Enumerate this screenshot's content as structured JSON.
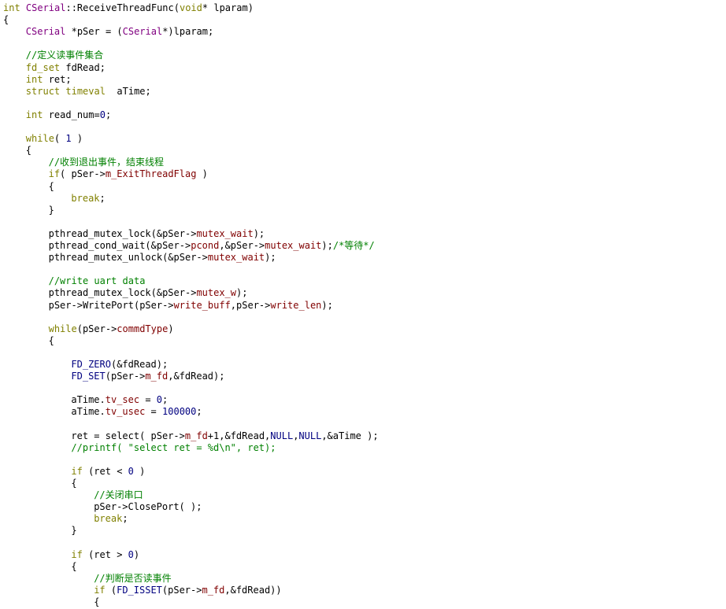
{
  "editor": {
    "lines": [
      {
        "t": 0,
        "indent": 0,
        "tokens": [
          {
            "c": "k",
            "v": "int "
          },
          {
            "c": "cls",
            "v": "CSerial"
          },
          {
            "c": "f",
            "v": "::ReceiveThreadFunc("
          },
          {
            "c": "k",
            "v": "void"
          },
          {
            "c": "f",
            "v": "* lparam)"
          }
        ]
      },
      {
        "t": 1,
        "indent": 0,
        "tokens": [
          {
            "c": "f",
            "v": "{"
          }
        ]
      },
      {
        "t": 2,
        "indent": 1,
        "tokens": [
          {
            "c": "cls",
            "v": "CSerial"
          },
          {
            "c": "f",
            "v": " *pSer = ("
          },
          {
            "c": "cls",
            "v": "CSerial"
          },
          {
            "c": "f",
            "v": "*)lparam;"
          }
        ]
      },
      {
        "t": 4,
        "indent": 1,
        "tokens": [
          {
            "c": "c",
            "v": "//定义读事件集合"
          }
        ]
      },
      {
        "t": 5,
        "indent": 1,
        "tokens": [
          {
            "c": "k",
            "v": "fd_set"
          },
          {
            "c": "f",
            "v": " fdRead;"
          }
        ]
      },
      {
        "t": 6,
        "indent": 1,
        "tokens": [
          {
            "c": "k",
            "v": "int"
          },
          {
            "c": "f",
            "v": " ret;"
          }
        ]
      },
      {
        "t": 7,
        "indent": 1,
        "tokens": [
          {
            "c": "k",
            "v": "struct timeval"
          },
          {
            "c": "f",
            "v": "  aTime;"
          }
        ]
      },
      {
        "t": 9,
        "indent": 1,
        "tokens": [
          {
            "c": "k",
            "v": "int"
          },
          {
            "c": "f",
            "v": " read_num="
          },
          {
            "c": "n",
            "v": "0"
          },
          {
            "c": "f",
            "v": ";"
          }
        ]
      },
      {
        "t": 11,
        "indent": 1,
        "tokens": [
          {
            "c": "k",
            "v": "while"
          },
          {
            "c": "f",
            "v": "( "
          },
          {
            "c": "n",
            "v": "1"
          },
          {
            "c": "f",
            "v": " )"
          }
        ]
      },
      {
        "t": 12,
        "indent": 1,
        "tokens": [
          {
            "c": "f",
            "v": "{"
          }
        ]
      },
      {
        "t": 13,
        "indent": 2,
        "tokens": [
          {
            "c": "c",
            "v": "//收到退出事件，结束线程"
          }
        ]
      },
      {
        "t": 14,
        "indent": 2,
        "tokens": [
          {
            "c": "k",
            "v": "if"
          },
          {
            "c": "f",
            "v": "( pSer->"
          },
          {
            "c": "m",
            "v": "m_ExitThreadFlag"
          },
          {
            "c": "f",
            "v": " )"
          }
        ]
      },
      {
        "t": 15,
        "indent": 2,
        "tokens": [
          {
            "c": "f",
            "v": "{"
          }
        ]
      },
      {
        "t": 16,
        "indent": 3,
        "tokens": [
          {
            "c": "k",
            "v": "break"
          },
          {
            "c": "f",
            "v": ";"
          }
        ]
      },
      {
        "t": 17,
        "indent": 2,
        "tokens": [
          {
            "c": "f",
            "v": "}"
          }
        ]
      },
      {
        "t": 19,
        "indent": 2,
        "tokens": [
          {
            "c": "f",
            "v": "pthread_mutex_lock(&pSer->"
          },
          {
            "c": "m",
            "v": "mutex_wait"
          },
          {
            "c": "f",
            "v": ");"
          }
        ]
      },
      {
        "t": 20,
        "indent": 2,
        "tokens": [
          {
            "c": "f",
            "v": "pthread_cond_wait(&pSer->"
          },
          {
            "c": "m",
            "v": "pcond"
          },
          {
            "c": "f",
            "v": ",&pSer->"
          },
          {
            "c": "m",
            "v": "mutex_wait"
          },
          {
            "c": "f",
            "v": ");"
          },
          {
            "c": "c",
            "v": "/*等待*/"
          }
        ]
      },
      {
        "t": 21,
        "indent": 2,
        "tokens": [
          {
            "c": "f",
            "v": "pthread_mutex_unlock(&pSer->"
          },
          {
            "c": "m",
            "v": "mutex_wait"
          },
          {
            "c": "f",
            "v": ");"
          }
        ]
      },
      {
        "t": 23,
        "indent": 2,
        "tokens": [
          {
            "c": "c",
            "v": "//write uart data"
          }
        ]
      },
      {
        "t": 24,
        "indent": 2,
        "tokens": [
          {
            "c": "f",
            "v": "pthread_mutex_lock(&pSer->"
          },
          {
            "c": "m",
            "v": "mutex_w"
          },
          {
            "c": "f",
            "v": ");"
          }
        ]
      },
      {
        "t": 25,
        "indent": 2,
        "tokens": [
          {
            "c": "f",
            "v": "pSer->WritePort(pSer->"
          },
          {
            "c": "m",
            "v": "write_buff"
          },
          {
            "c": "f",
            "v": ",pSer->"
          },
          {
            "c": "m",
            "v": "write_len"
          },
          {
            "c": "f",
            "v": ");"
          }
        ]
      },
      {
        "t": 27,
        "indent": 2,
        "tokens": [
          {
            "c": "k",
            "v": "while"
          },
          {
            "c": "f",
            "v": "(pSer->"
          },
          {
            "c": "m",
            "v": "commdType"
          },
          {
            "c": "f",
            "v": ")"
          }
        ]
      },
      {
        "t": 28,
        "indent": 2,
        "tokens": [
          {
            "c": "f",
            "v": "{"
          }
        ]
      },
      {
        "t": 30,
        "indent": 3,
        "tokens": [
          {
            "c": "n",
            "v": "FD_ZERO"
          },
          {
            "c": "f",
            "v": "(&fdRead);"
          }
        ]
      },
      {
        "t": 31,
        "indent": 3,
        "tokens": [
          {
            "c": "n",
            "v": "FD_SET"
          },
          {
            "c": "f",
            "v": "(pSer->"
          },
          {
            "c": "m",
            "v": "m_fd"
          },
          {
            "c": "f",
            "v": ",&fdRead);"
          }
        ]
      },
      {
        "t": 33,
        "indent": 3,
        "tokens": [
          {
            "c": "f",
            "v": "aTime."
          },
          {
            "c": "m",
            "v": "tv_sec"
          },
          {
            "c": "f",
            "v": " = "
          },
          {
            "c": "n",
            "v": "0"
          },
          {
            "c": "f",
            "v": ";"
          }
        ]
      },
      {
        "t": 34,
        "indent": 3,
        "tokens": [
          {
            "c": "f",
            "v": "aTime."
          },
          {
            "c": "m",
            "v": "tv_usec"
          },
          {
            "c": "f",
            "v": " = "
          },
          {
            "c": "n",
            "v": "100000"
          },
          {
            "c": "f",
            "v": ";"
          }
        ]
      },
      {
        "t": 36,
        "indent": 3,
        "tokens": [
          {
            "c": "f",
            "v": "ret = select( pSer->"
          },
          {
            "c": "m",
            "v": "m_fd"
          },
          {
            "c": "f",
            "v": "+1,&fdRead,"
          },
          {
            "c": "n",
            "v": "NULL"
          },
          {
            "c": "f",
            "v": ","
          },
          {
            "c": "n",
            "v": "NULL"
          },
          {
            "c": "f",
            "v": ",&aTime );"
          }
        ]
      },
      {
        "t": 37,
        "indent": 3,
        "tokens": [
          {
            "c": "c",
            "v": "//printf( \"select ret = %d\\n\", ret);"
          }
        ]
      },
      {
        "t": 39,
        "indent": 3,
        "tokens": [
          {
            "c": "k",
            "v": "if"
          },
          {
            "c": "f",
            "v": " (ret < "
          },
          {
            "c": "n",
            "v": "0"
          },
          {
            "c": "f",
            "v": " )"
          }
        ]
      },
      {
        "t": 40,
        "indent": 3,
        "tokens": [
          {
            "c": "f",
            "v": "{"
          }
        ]
      },
      {
        "t": 41,
        "indent": 4,
        "tokens": [
          {
            "c": "c",
            "v": "//关闭串口"
          }
        ]
      },
      {
        "t": 42,
        "indent": 4,
        "tokens": [
          {
            "c": "f",
            "v": "pSer->ClosePort( );"
          }
        ]
      },
      {
        "t": 43,
        "indent": 4,
        "tokens": [
          {
            "c": "k",
            "v": "break"
          },
          {
            "c": "f",
            "v": ";"
          }
        ]
      },
      {
        "t": 44,
        "indent": 3,
        "tokens": [
          {
            "c": "f",
            "v": "}"
          }
        ]
      },
      {
        "t": 46,
        "indent": 3,
        "tokens": [
          {
            "c": "k",
            "v": "if"
          },
          {
            "c": "f",
            "v": " (ret > "
          },
          {
            "c": "n",
            "v": "0"
          },
          {
            "c": "f",
            "v": ")"
          }
        ]
      },
      {
        "t": 47,
        "indent": 3,
        "tokens": [
          {
            "c": "f",
            "v": "{"
          }
        ]
      },
      {
        "t": 48,
        "indent": 4,
        "tokens": [
          {
            "c": "c",
            "v": "//判断是否读事件"
          }
        ]
      },
      {
        "t": 49,
        "indent": 4,
        "tokens": [
          {
            "c": "k",
            "v": "if"
          },
          {
            "c": "f",
            "v": " ("
          },
          {
            "c": "n",
            "v": "FD_ISSET"
          },
          {
            "c": "f",
            "v": "(pSer->"
          },
          {
            "c": "m",
            "v": "m_fd"
          },
          {
            "c": "f",
            "v": ",&fdRead))"
          }
        ]
      },
      {
        "t": 50,
        "indent": 4,
        "tokens": [
          {
            "c": "f",
            "v": "{"
          }
        ]
      }
    ]
  }
}
